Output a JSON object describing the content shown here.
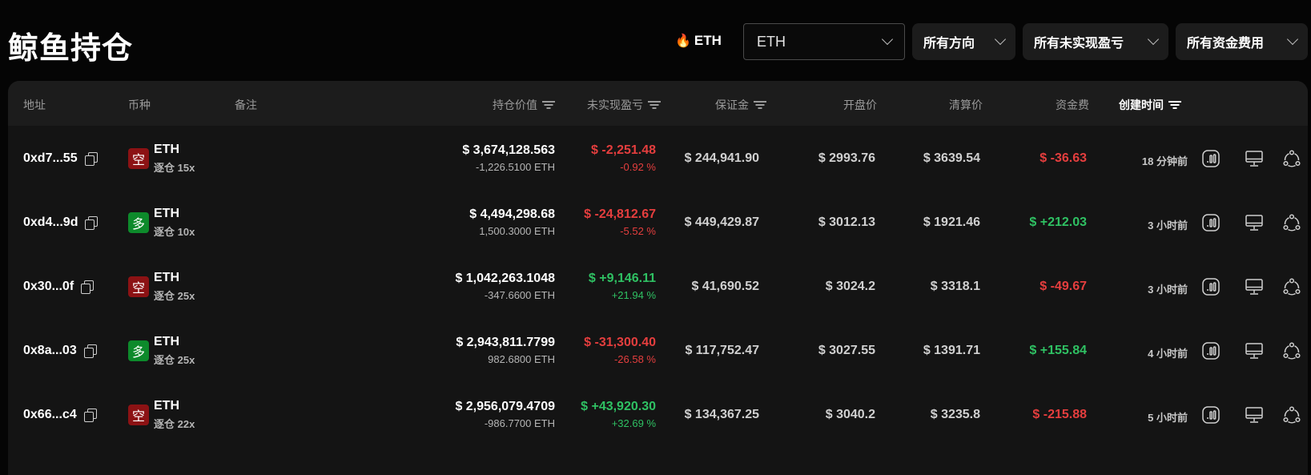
{
  "page": {
    "title": "鲸鱼持仓"
  },
  "filters": {
    "hot_tag": "ETH",
    "hot_icon": "fire-icon",
    "coin_select": "ETH",
    "direction": "所有方向",
    "unrealized_pnl": "所有未实现盈亏",
    "funding_fee": "所有资金费用"
  },
  "columns": {
    "address": "地址",
    "coin": "币种",
    "note": "备注",
    "position_value": "持仓价值",
    "unrealized_pnl": "未实现盈亏",
    "margin": "保证金",
    "open_price": "开盘价",
    "liq_price": "清算价",
    "funding": "资金费",
    "created": "创建时间"
  },
  "colors": {
    "short": "#8c1214",
    "long": "#0d8a2b",
    "negative": "#e53e3e",
    "positive": "#2fc163"
  },
  "rows": [
    {
      "address": "0xd7...55",
      "side": "空",
      "side_type": "short",
      "coin": "ETH",
      "leverage": "逐仓 15x",
      "value": "$ 3,674,128.563",
      "size": "-1,226.5100 ETH",
      "pnl": "$ -2,251.48",
      "pnl_pct": "-0.92 %",
      "pnl_sign": "neg",
      "margin": "$ 244,941.90",
      "open": "$ 2993.76",
      "liq": "$ 3639.54",
      "funding": "$ -36.63",
      "funding_sign": "neg",
      "created": "18 分钟前"
    },
    {
      "address": "0xd4...9d",
      "side": "多",
      "side_type": "long",
      "coin": "ETH",
      "leverage": "逐仓 10x",
      "value": "$ 4,494,298.68",
      "size": "1,500.3000 ETH",
      "pnl": "$ -24,812.67",
      "pnl_pct": "-5.52 %",
      "pnl_sign": "neg",
      "margin": "$ 449,429.87",
      "open": "$ 3012.13",
      "liq": "$ 1921.46",
      "funding": "$ +212.03",
      "funding_sign": "pos",
      "created": "3 小时前"
    },
    {
      "address": "0x30...0f",
      "side": "空",
      "side_type": "short",
      "coin": "ETH",
      "leverage": "逐仓 25x",
      "value": "$ 1,042,263.1048",
      "size": "-347.6600 ETH",
      "pnl": "$ +9,146.11",
      "pnl_pct": "+21.94 %",
      "pnl_sign": "pos",
      "margin": "$ 41,690.52",
      "open": "$ 3024.2",
      "liq": "$ 3318.1",
      "funding": "$ -49.67",
      "funding_sign": "neg",
      "created": "3 小时前"
    },
    {
      "address": "0x8a...03",
      "side": "多",
      "side_type": "long",
      "coin": "ETH",
      "leverage": "逐仓 25x",
      "value": "$ 2,943,811.7799",
      "size": "982.6800 ETH",
      "pnl": "$ -31,300.40",
      "pnl_pct": "-26.58 %",
      "pnl_sign": "neg",
      "margin": "$ 117,752.47",
      "open": "$ 3027.55",
      "liq": "$ 1391.71",
      "funding": "$ +155.84",
      "funding_sign": "pos",
      "created": "4 小时前"
    },
    {
      "address": "0x66...c4",
      "side": "空",
      "side_type": "short",
      "coin": "ETH",
      "leverage": "逐仓 22x",
      "value": "$ 2,956,079.4709",
      "size": "-986.7700 ETH",
      "pnl": "$ +43,920.30",
      "pnl_pct": "+32.69 %",
      "pnl_sign": "pos",
      "margin": "$ 134,367.25",
      "open": "$ 3040.2",
      "liq": "$ 3235.8",
      "funding": "$ -215.88",
      "funding_sign": "neg",
      "created": "5 小时前"
    }
  ],
  "row_actions": [
    "chart-icon",
    "monitor-icon",
    "share-icon"
  ]
}
